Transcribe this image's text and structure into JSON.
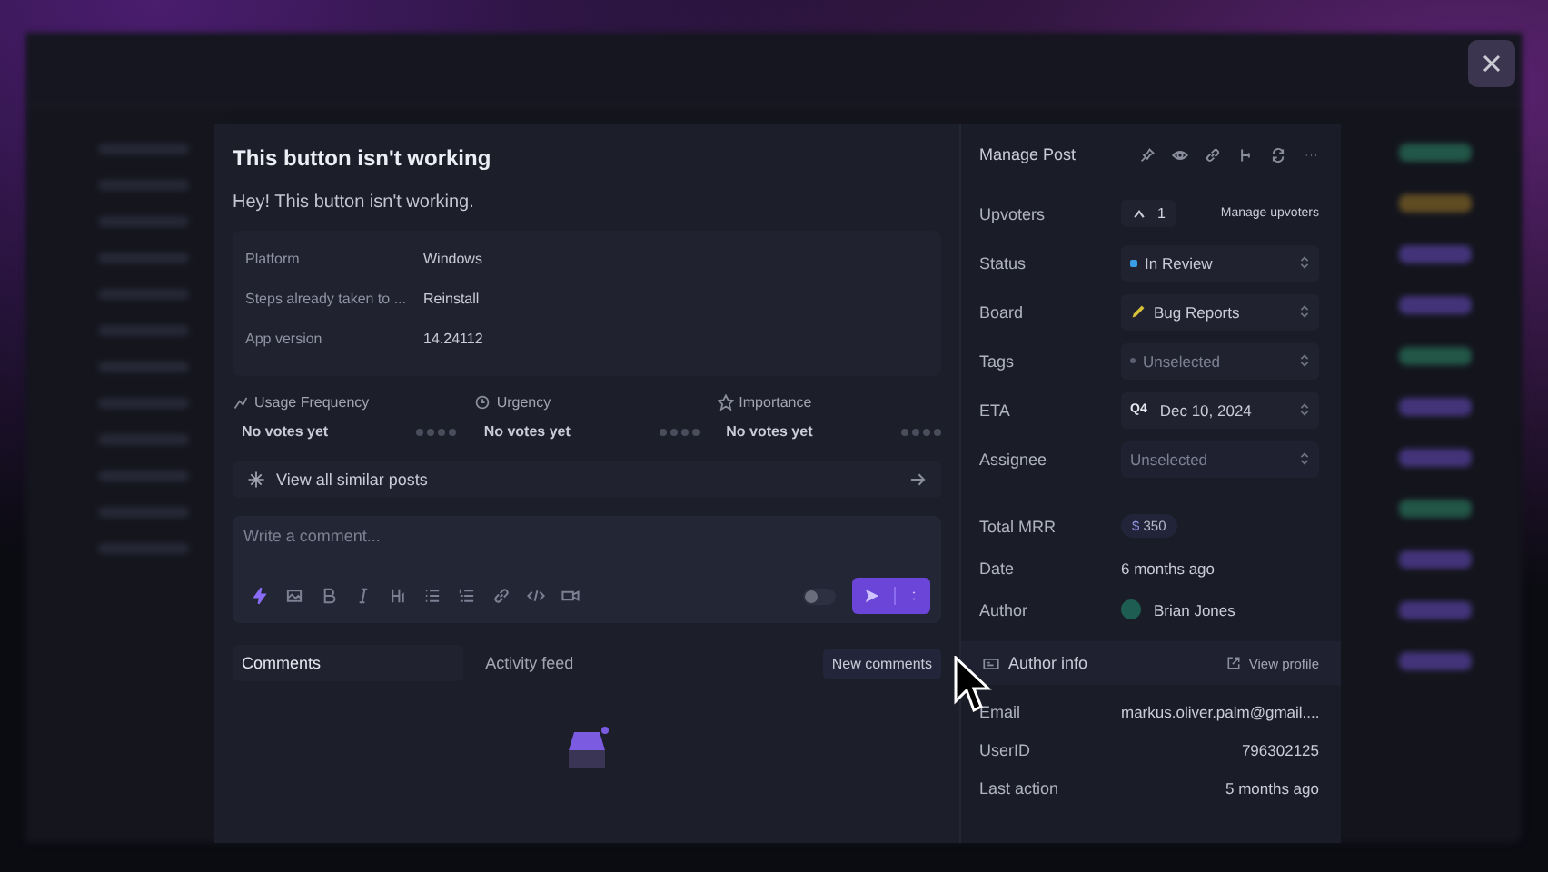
{
  "post": {
    "title": "This button isn't working",
    "body": "Hey! This button isn't working.",
    "fields": [
      {
        "label": "Platform",
        "value": "Windows"
      },
      {
        "label": "Steps already taken to ...",
        "value": "Reinstall"
      },
      {
        "label": "App version",
        "value": "14.24112"
      }
    ],
    "ratings": [
      {
        "kind": "frequency",
        "label": "Usage Frequency",
        "value": "No votes yet",
        "stars": 0
      },
      {
        "kind": "urgency",
        "label": "Urgency",
        "value": "No votes yet",
        "stars": 0
      },
      {
        "kind": "importance",
        "label": "Importance",
        "value": "No votes yet",
        "stars": 0
      }
    ],
    "similar_link": "View all similar posts"
  },
  "comment_box": {
    "placeholder": "Write a comment...",
    "toggle_on": false
  },
  "tabs": [
    {
      "label": "Comments",
      "selected": true
    },
    {
      "label": "Activity feed",
      "selected": false
    }
  ],
  "new_comments": "New comments",
  "manage": {
    "title": "Manage Post",
    "upvoters": {
      "label": "Upvoters",
      "count": "1",
      "action": "Manage upvoters"
    },
    "properties": [
      {
        "kind": "status",
        "label": "Status",
        "value": "In Review",
        "color": "#3a9ee4"
      },
      {
        "kind": "board",
        "label": "Board",
        "value": "Bug Reports"
      },
      {
        "kind": "select",
        "label": "Tags",
        "placeholder": "Unselected"
      },
      {
        "kind": "eta",
        "label": "ETA",
        "badge": "Q4",
        "value": "Dec 10, 2024"
      },
      {
        "kind": "plain",
        "label": "Assignee",
        "placeholder": "Unselected"
      }
    ],
    "details": [
      {
        "kind": "money",
        "label": "Total MRR",
        "prefix": "$",
        "value": "350"
      },
      {
        "kind": "text",
        "label": "Date",
        "value": "6 months ago"
      },
      {
        "kind": "user",
        "label": "Author",
        "value": "Brian Jones"
      }
    ],
    "author_info": {
      "title": "Author info",
      "link": "View profile",
      "rows": [
        {
          "label": "Email",
          "value": "markus.oliver.palm@gmail...."
        },
        {
          "label": "UserID",
          "value": "796302125"
        },
        {
          "label": "Last action",
          "value": "5 months ago"
        }
      ]
    }
  }
}
